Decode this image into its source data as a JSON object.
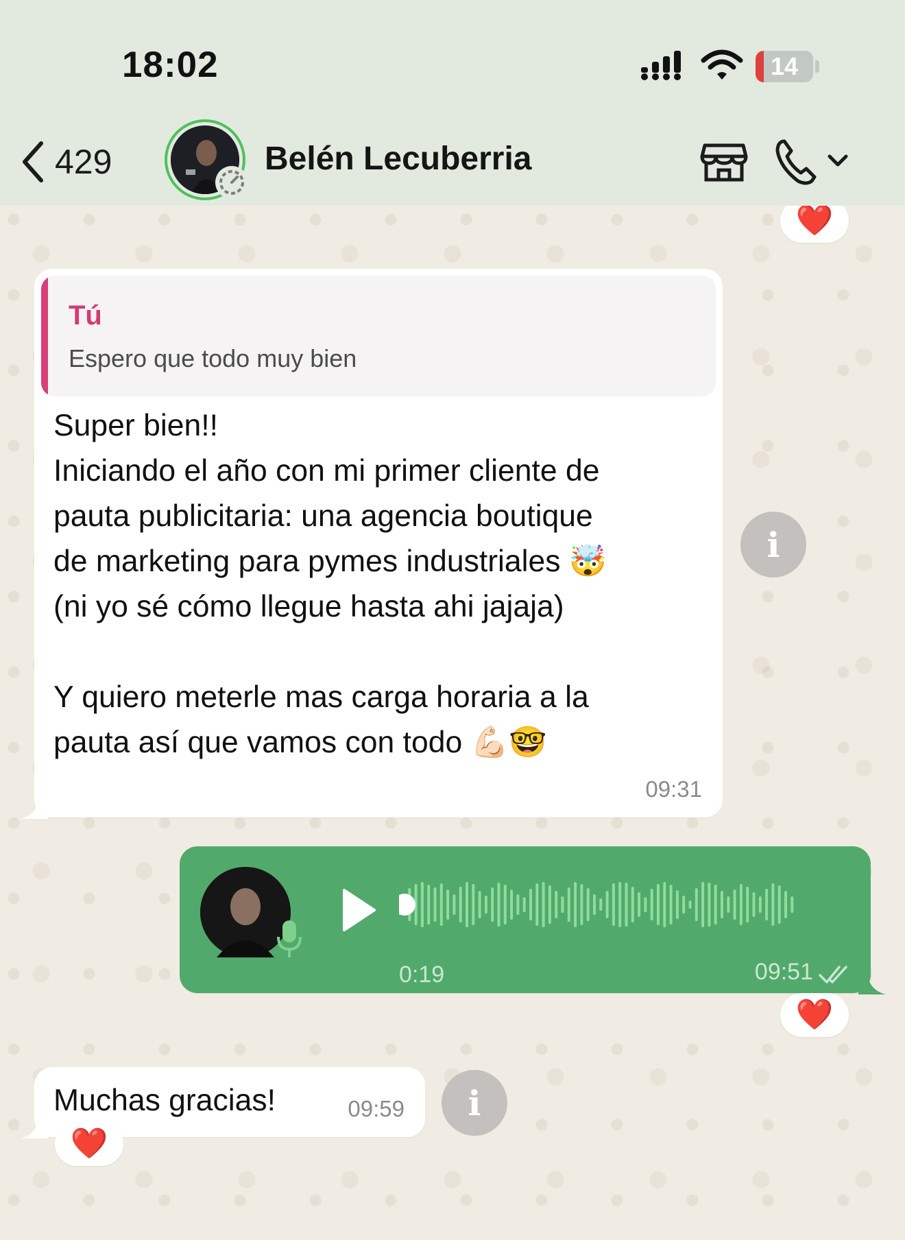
{
  "status_bar": {
    "time": "18:02",
    "battery_level": "14",
    "battery_fraction": 0.14
  },
  "header": {
    "back_count": "429",
    "contact_name": "Belén Lecuberria"
  },
  "messages": {
    "first_reaction": "❤️",
    "incoming_1": {
      "quote_author": "Tú",
      "quote_text": "Espero que todo muy bien",
      "text": "Super bien!!\nIniciando el año con mi primer cliente de\npauta publicitaria: una agencia boutique\nde marketing para pymes industriales 🤯\n(ni yo sé cómo llegue hasta ahi jajaja)\n\nY quiero meterle mas carga horaria a la\npauta así que vamos con todo 💪🏻🤓",
      "time": "09:31"
    },
    "outgoing_voice": {
      "duration": "0:19",
      "time": "09:51",
      "reaction": "❤️",
      "progress": 0.0
    },
    "incoming_2": {
      "text": "Muchas gracias!",
      "time": "09:59",
      "reaction": "❤️"
    },
    "info_glyph": "i"
  },
  "colors": {
    "header_bg": "#e2eae0",
    "chat_bg": "#f1ece3",
    "outgoing_bubble": "#51aa6b",
    "quote_accent": "#d83e79",
    "story_ring": "#4fc15c"
  },
  "icons": {
    "back": "chevron-left-icon",
    "store": "store-icon",
    "call": "phone-icon",
    "call_menu": "chevron-down-icon",
    "info": "info-icon",
    "play": "play-icon",
    "mic": "microphone-icon",
    "read_receipt": "double-check-icon"
  }
}
